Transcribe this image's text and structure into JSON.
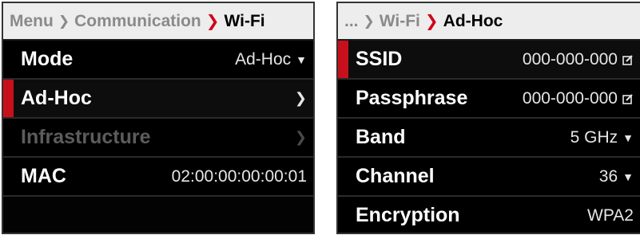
{
  "left": {
    "breadcrumb": {
      "items": [
        "Menu",
        "Communication"
      ],
      "current": "Wi-Fi"
    },
    "rows": [
      {
        "label": "Mode",
        "value": "Ad-Hoc"
      },
      {
        "label": "Ad-Hoc"
      },
      {
        "label": "Infrastructure"
      },
      {
        "label": "MAC",
        "value": "02:00:00:00:00:01"
      }
    ]
  },
  "right": {
    "breadcrumb": {
      "items": [
        "...",
        "Wi-Fi"
      ],
      "current": "Ad-Hoc"
    },
    "rows": [
      {
        "label": "SSID",
        "value": "000-000-000"
      },
      {
        "label": "Passphrase",
        "value": "000-000-000"
      },
      {
        "label": "Band",
        "value": "5 GHz"
      },
      {
        "label": "Channel",
        "value": "36"
      },
      {
        "label": "Encryption",
        "value": "WPA2"
      }
    ]
  },
  "glyphs": {
    "chevron_right": "❯",
    "dropdown": "▼",
    "crumb_sep": "❯",
    "crumb_sep_active": "❯"
  },
  "colors": {
    "accent_red": "#c8101c",
    "breadcrumb_bg": "#ededed",
    "row_bg": "#000000"
  }
}
